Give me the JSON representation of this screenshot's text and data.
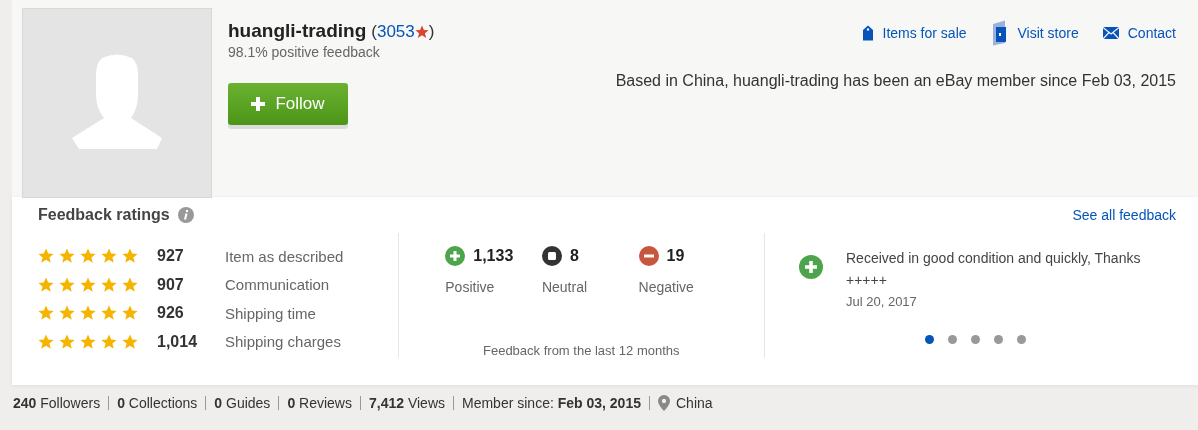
{
  "seller": {
    "name": "huangli-trading",
    "score_open": "(",
    "score": "3053",
    "score_close": ")",
    "positive": "98.1% positive feedback",
    "follow_button": "Follow",
    "about": "Based in China, huangli-trading has been an eBay member since Feb 03, 2015"
  },
  "links": [
    {
      "kind": "tag",
      "label": "Items for sale"
    },
    {
      "kind": "store",
      "label": "Visit store"
    },
    {
      "kind": "mail",
      "label": "Contact"
    }
  ],
  "ratings": {
    "title": "Feedback ratings",
    "see_all": "See all feedback",
    "detailed": [
      {
        "stars": 5,
        "count": "927",
        "label": "Item as described"
      },
      {
        "stars": 5,
        "count": "907",
        "label": "Communication"
      },
      {
        "stars": 5,
        "count": "926",
        "label": "Shipping time"
      },
      {
        "stars": 5,
        "count": "1,014",
        "label": "Shipping charges"
      }
    ],
    "summary": [
      {
        "kind": "positive",
        "count": "1,133",
        "label": "Positive"
      },
      {
        "kind": "neutral",
        "count": "8",
        "label": "Neutral"
      },
      {
        "kind": "negative",
        "count": "19",
        "label": "Negative"
      }
    ],
    "period": "Feedback from the last 12 months",
    "comment": {
      "kind": "positive",
      "text": "Received in good condition and quickly, Thanks +++++",
      "date": "Jul 20, 2017"
    },
    "pager": [
      {
        "selected": true
      },
      {
        "selected": false
      },
      {
        "selected": false
      },
      {
        "selected": false
      },
      {
        "selected": false
      }
    ]
  },
  "stats": [
    {
      "kind": "stat",
      "text": "**240** Followers"
    },
    {
      "kind": "stat",
      "text": "**0** Collections"
    },
    {
      "kind": "stat",
      "text": "**0** Guides"
    },
    {
      "kind": "stat",
      "text": "**0** Reviews"
    },
    {
      "kind": "stat",
      "text": "**7,412** Views"
    },
    {
      "kind": "stat",
      "text": "Member since: **Feb 03, 2015**"
    },
    {
      "kind": "location",
      "text": "China"
    }
  ]
}
